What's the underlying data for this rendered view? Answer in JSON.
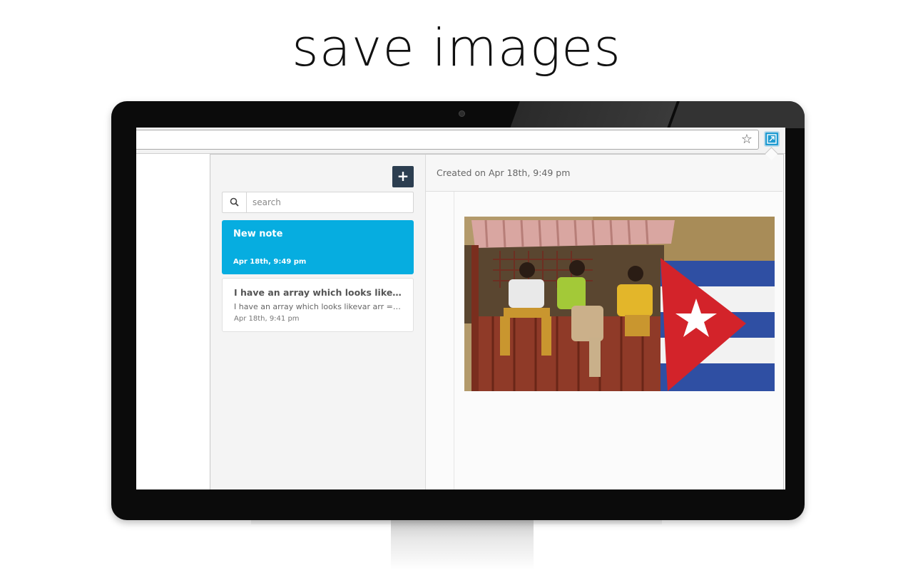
{
  "headline": "save images",
  "browser": {
    "bookmark_icon": "star-icon",
    "extension_icon": "note-extension-icon"
  },
  "sidebar": {
    "add_button": "+",
    "search": {
      "placeholder": "search",
      "value": ""
    },
    "notes": [
      {
        "title": "New note",
        "preview": "",
        "date": "Apr 18th, 9:49 pm",
        "active": true
      },
      {
        "title": "I have an array which looks likevar arr = [\"a|c\", \"a|e\", \"x|z\"];",
        "preview": "I have an array which looks likevar arr = [\"a|c\", \"a|e\", \"x|z\"];",
        "date": "Apr 18th, 9:41 pm",
        "active": false
      }
    ]
  },
  "main": {
    "created_label": "Created on Apr 18th, 9:49 pm",
    "image_description": "photo-people-under-shelter-with-cuban-flag"
  },
  "colors": {
    "accent": "#06ade0",
    "add_button_bg": "#2c3e50",
    "extension_bg": "#1f9bd1"
  }
}
